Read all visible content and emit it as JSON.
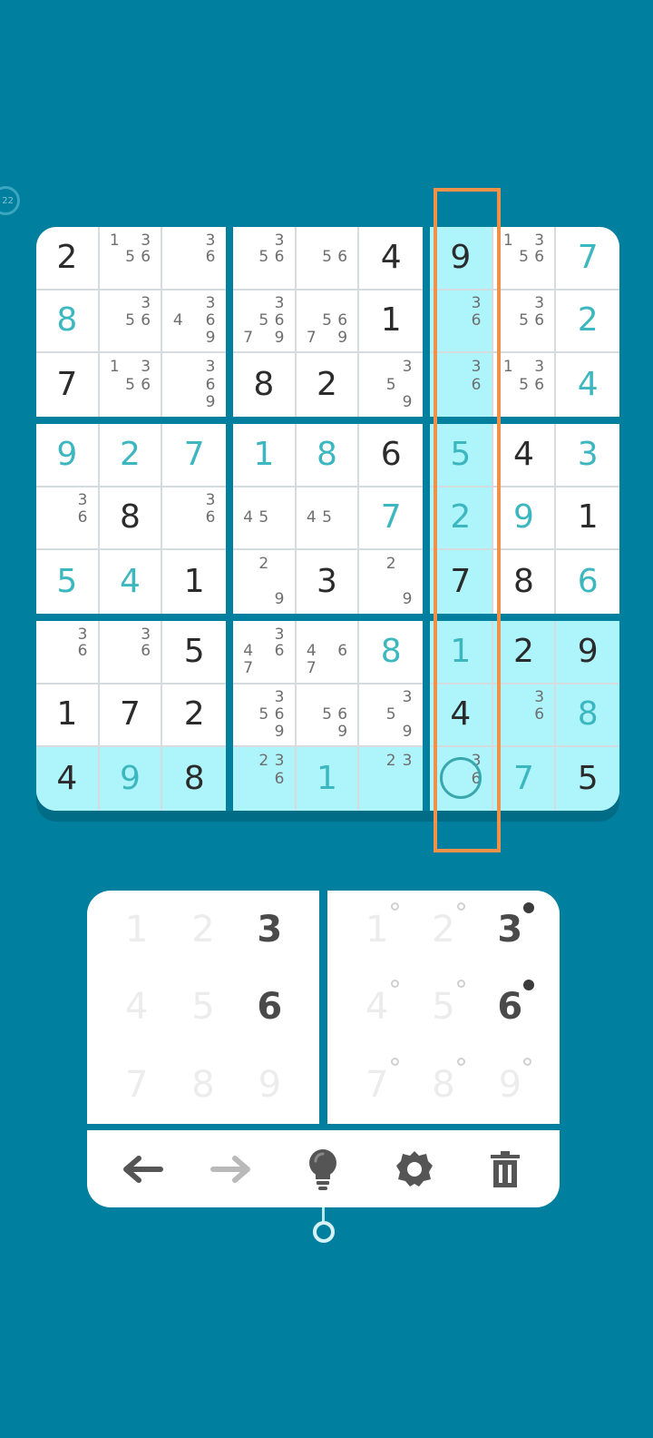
{
  "timer": {
    "label": "22"
  },
  "colors": {
    "background": "#00809e",
    "given": "#2b2b2b",
    "user": "#3db7bf",
    "highlight": "#aef4fb",
    "frame": "#f0914a"
  },
  "board": {
    "selected": [
      8,
      6
    ],
    "cells": [
      [
        {
          "v": "2",
          "t": "g"
        },
        {
          "n": "1356"
        },
        {
          "n": "36"
        },
        {
          "n": "356"
        },
        {
          "n": "56"
        },
        {
          "v": "4",
          "t": "g"
        },
        {
          "v": "9",
          "t": "g"
        },
        {
          "n": "1356"
        },
        {
          "v": "7",
          "t": "u"
        }
      ],
      [
        {
          "v": "8",
          "t": "u"
        },
        {
          "n": "356"
        },
        {
          "n": "3469"
        },
        {
          "n": "35679"
        },
        {
          "n": "5679"
        },
        {
          "v": "1",
          "t": "g"
        },
        {
          "n": "36"
        },
        {
          "n": "356"
        },
        {
          "v": "2",
          "t": "u"
        }
      ],
      [
        {
          "v": "7",
          "t": "g"
        },
        {
          "n": "1356"
        },
        {
          "n": "369"
        },
        {
          "v": "8",
          "t": "g"
        },
        {
          "v": "2",
          "t": "g"
        },
        {
          "n": "359"
        },
        {
          "n": "36"
        },
        {
          "n": "1356"
        },
        {
          "v": "4",
          "t": "u"
        }
      ],
      [
        {
          "v": "9",
          "t": "u"
        },
        {
          "v": "2",
          "t": "u"
        },
        {
          "v": "7",
          "t": "u"
        },
        {
          "v": "1",
          "t": "u"
        },
        {
          "v": "8",
          "t": "u"
        },
        {
          "v": "6",
          "t": "g"
        },
        {
          "v": "5",
          "t": "u"
        },
        {
          "v": "4",
          "t": "g"
        },
        {
          "v": "3",
          "t": "u"
        }
      ],
      [
        {
          "n": "36"
        },
        {
          "v": "8",
          "t": "g"
        },
        {
          "n": "36"
        },
        {
          "n": "45"
        },
        {
          "n": "45"
        },
        {
          "v": "7",
          "t": "u"
        },
        {
          "v": "2",
          "t": "u"
        },
        {
          "v": "9",
          "t": "u"
        },
        {
          "v": "1",
          "t": "g"
        }
      ],
      [
        {
          "v": "5",
          "t": "u"
        },
        {
          "v": "4",
          "t": "u"
        },
        {
          "v": "1",
          "t": "g"
        },
        {
          "n": "29"
        },
        {
          "v": "3",
          "t": "g"
        },
        {
          "n": "29"
        },
        {
          "v": "7",
          "t": "g"
        },
        {
          "v": "8",
          "t": "g"
        },
        {
          "v": "6",
          "t": "u"
        }
      ],
      [
        {
          "n": "36"
        },
        {
          "n": "36"
        },
        {
          "v": "5",
          "t": "g"
        },
        {
          "n": "3467"
        },
        {
          "n": "467"
        },
        {
          "v": "8",
          "t": "u"
        },
        {
          "v": "1",
          "t": "u"
        },
        {
          "v": "2",
          "t": "g"
        },
        {
          "v": "9",
          "t": "g"
        }
      ],
      [
        {
          "v": "1",
          "t": "g"
        },
        {
          "v": "7",
          "t": "g"
        },
        {
          "v": "2",
          "t": "g"
        },
        {
          "n": "3569"
        },
        {
          "n": "569"
        },
        {
          "n": "359"
        },
        {
          "v": "4",
          "t": "g"
        },
        {
          "n": "36"
        },
        {
          "v": "8",
          "t": "u"
        }
      ],
      [
        {
          "v": "4",
          "t": "g"
        },
        {
          "v": "9",
          "t": "u"
        },
        {
          "v": "8",
          "t": "g"
        },
        {
          "n": "236"
        },
        {
          "v": "1",
          "t": "u"
        },
        {
          "n": "23"
        },
        {
          "n": "36"
        },
        {
          "v": "7",
          "t": "u"
        },
        {
          "v": "5",
          "t": "g"
        }
      ]
    ]
  },
  "pads": {
    "numbers": [
      {
        "label": "1",
        "on": false
      },
      {
        "label": "2",
        "on": false
      },
      {
        "label": "3",
        "on": true
      },
      {
        "label": "4",
        "on": false
      },
      {
        "label": "5",
        "on": false
      },
      {
        "label": "6",
        "on": true
      },
      {
        "label": "7",
        "on": false
      },
      {
        "label": "8",
        "on": false
      },
      {
        "label": "9",
        "on": false
      }
    ],
    "notes": [
      {
        "label": "1",
        "on": false
      },
      {
        "label": "2",
        "on": false
      },
      {
        "label": "3",
        "on": true
      },
      {
        "label": "4",
        "on": false
      },
      {
        "label": "5",
        "on": false
      },
      {
        "label": "6",
        "on": true
      },
      {
        "label": "7",
        "on": false
      },
      {
        "label": "8",
        "on": false
      },
      {
        "label": "9",
        "on": false
      }
    ]
  },
  "toolbar": {
    "items": [
      {
        "icon": "undo-arrow-icon",
        "name": "undo-button"
      },
      {
        "icon": "redo-arrow-icon",
        "name": "redo-button"
      },
      {
        "icon": "lightbulb-icon",
        "name": "hint-button"
      },
      {
        "icon": "gear-icon",
        "name": "settings-button"
      },
      {
        "icon": "trash-icon",
        "name": "erase-button"
      }
    ]
  }
}
